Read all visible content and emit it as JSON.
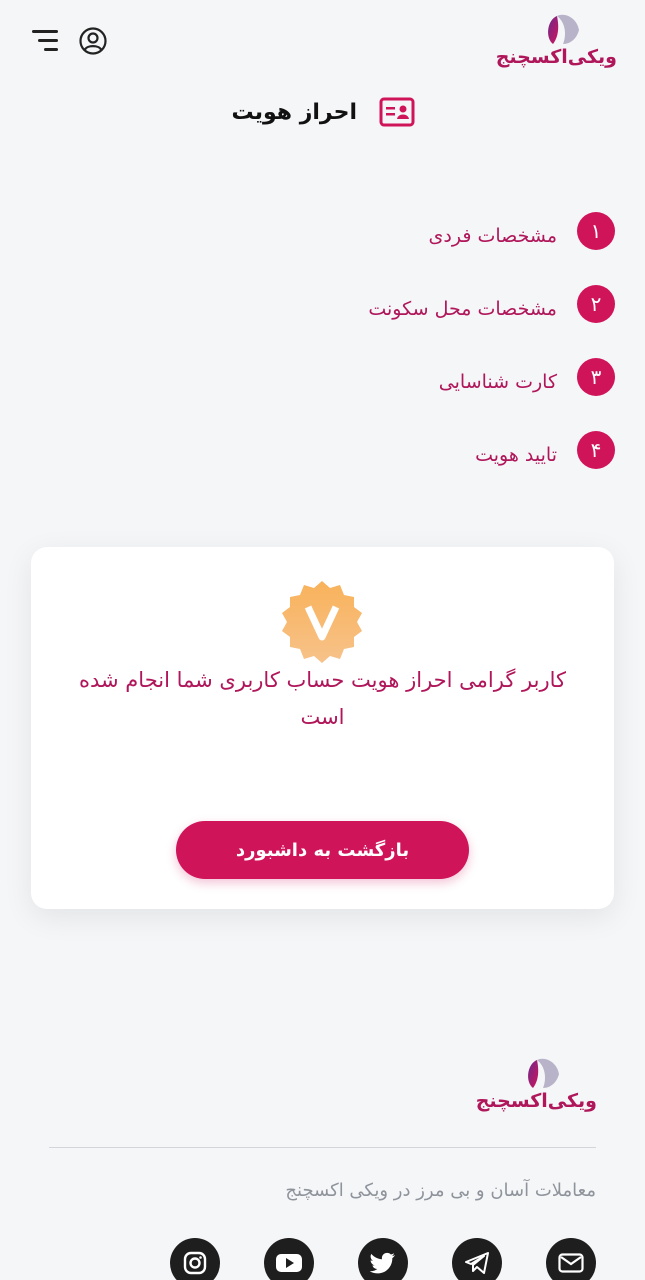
{
  "brand": {
    "name": "ویکی‌اکسچنج",
    "accent": "#d0145a",
    "accent_text": "#b0165a"
  },
  "header": {
    "menu_icon": "hamburger-icon",
    "user_icon": "user-circle-icon"
  },
  "page": {
    "title": "احراز هویت",
    "title_icon": "id-card-icon"
  },
  "steps": [
    {
      "number": "۱",
      "label": "مشخصات فردی"
    },
    {
      "number": "۲",
      "label": "مشخصات محل سکونت"
    },
    {
      "number": "۳",
      "label": "کارت شناسایی"
    },
    {
      "number": "۴",
      "label": "تایید هویت"
    }
  ],
  "card": {
    "badge_icon": "verified-badge-icon",
    "message": "کاربر گرامی احراز هویت حساب کاربری شما انجام شده است",
    "button_label": "بازگشت به داشبورد"
  },
  "footer": {
    "tagline": "معاملات آسان و بی مرز در ویکی اکسچنج",
    "socials": [
      "instagram-icon",
      "youtube-icon",
      "twitter-icon",
      "telegram-icon",
      "email-icon"
    ]
  }
}
